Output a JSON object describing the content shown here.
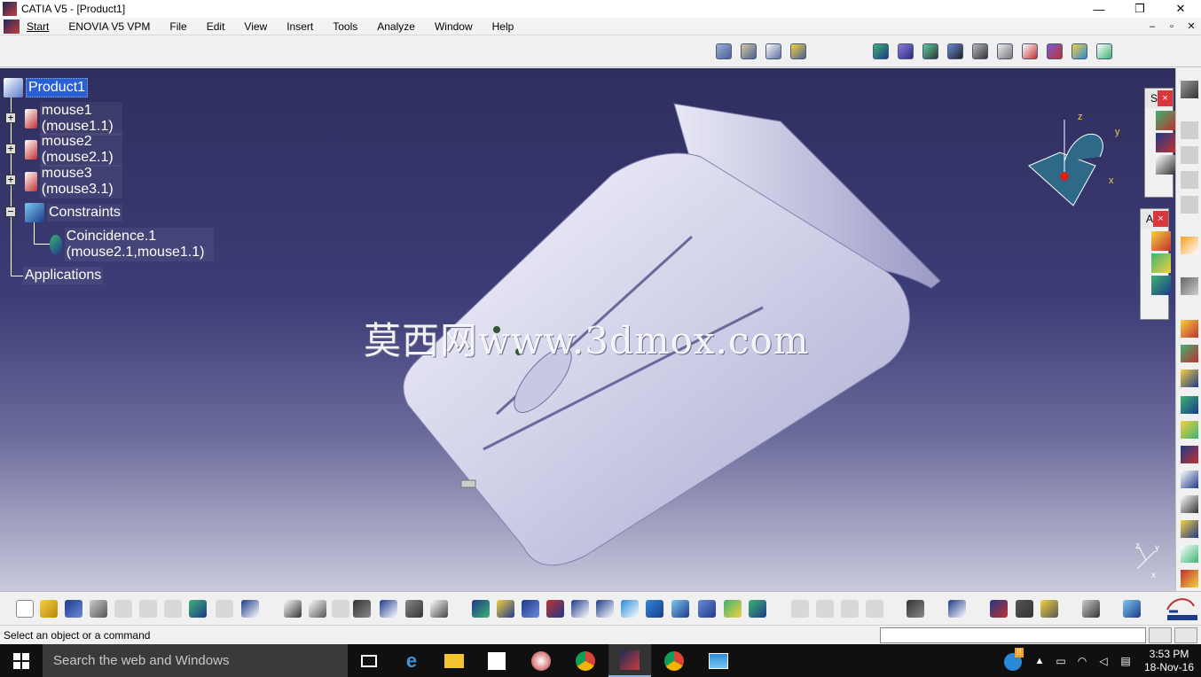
{
  "window": {
    "title": "CATIA V5 - [Product1]",
    "controls": {
      "minimize": "—",
      "restore": "❐",
      "close": "✕"
    }
  },
  "menubar": {
    "items": [
      "Start",
      "ENOVIA V5 VPM",
      "File",
      "Edit",
      "View",
      "Insert",
      "Tools",
      "Analyze",
      "Window",
      "Help"
    ],
    "doc_controls": [
      "–",
      "▫",
      "✕"
    ]
  },
  "tree": {
    "root": "Product1",
    "children": [
      {
        "label": "mouse1 (mouse1.1)",
        "expander": "+"
      },
      {
        "label": "mouse2 (mouse2.1)",
        "expander": "+"
      },
      {
        "label": "mouse3 (mouse3.1)",
        "expander": "+"
      },
      {
        "label": "Constraints",
        "expander": "−"
      }
    ],
    "constraint": "Coincidence.1 (mouse2.1,mouse1.1)",
    "applications": "Applications"
  },
  "watermark": "莫西网www.3dmox.com",
  "compass": {
    "x": "x",
    "y": "y",
    "z": "z"
  },
  "axis_indicator": {
    "x": "x",
    "y": "y",
    "z": "z"
  },
  "panels": {
    "panel1_title": "S",
    "panel2_title": "A",
    "close": "×"
  },
  "status": {
    "text": "Select an object or a command",
    "command_input": ""
  },
  "taskbar": {
    "search_placeholder": "Search the web and Windows",
    "time": "3:53 PM",
    "date": "18-Nov-16",
    "notification_badge": "!!"
  },
  "colors": {
    "viewport_top": "#2e2e5e",
    "viewport_bottom": "#c9c9dc",
    "part": "#dcdcf0",
    "selection": "#2a5fd6"
  }
}
